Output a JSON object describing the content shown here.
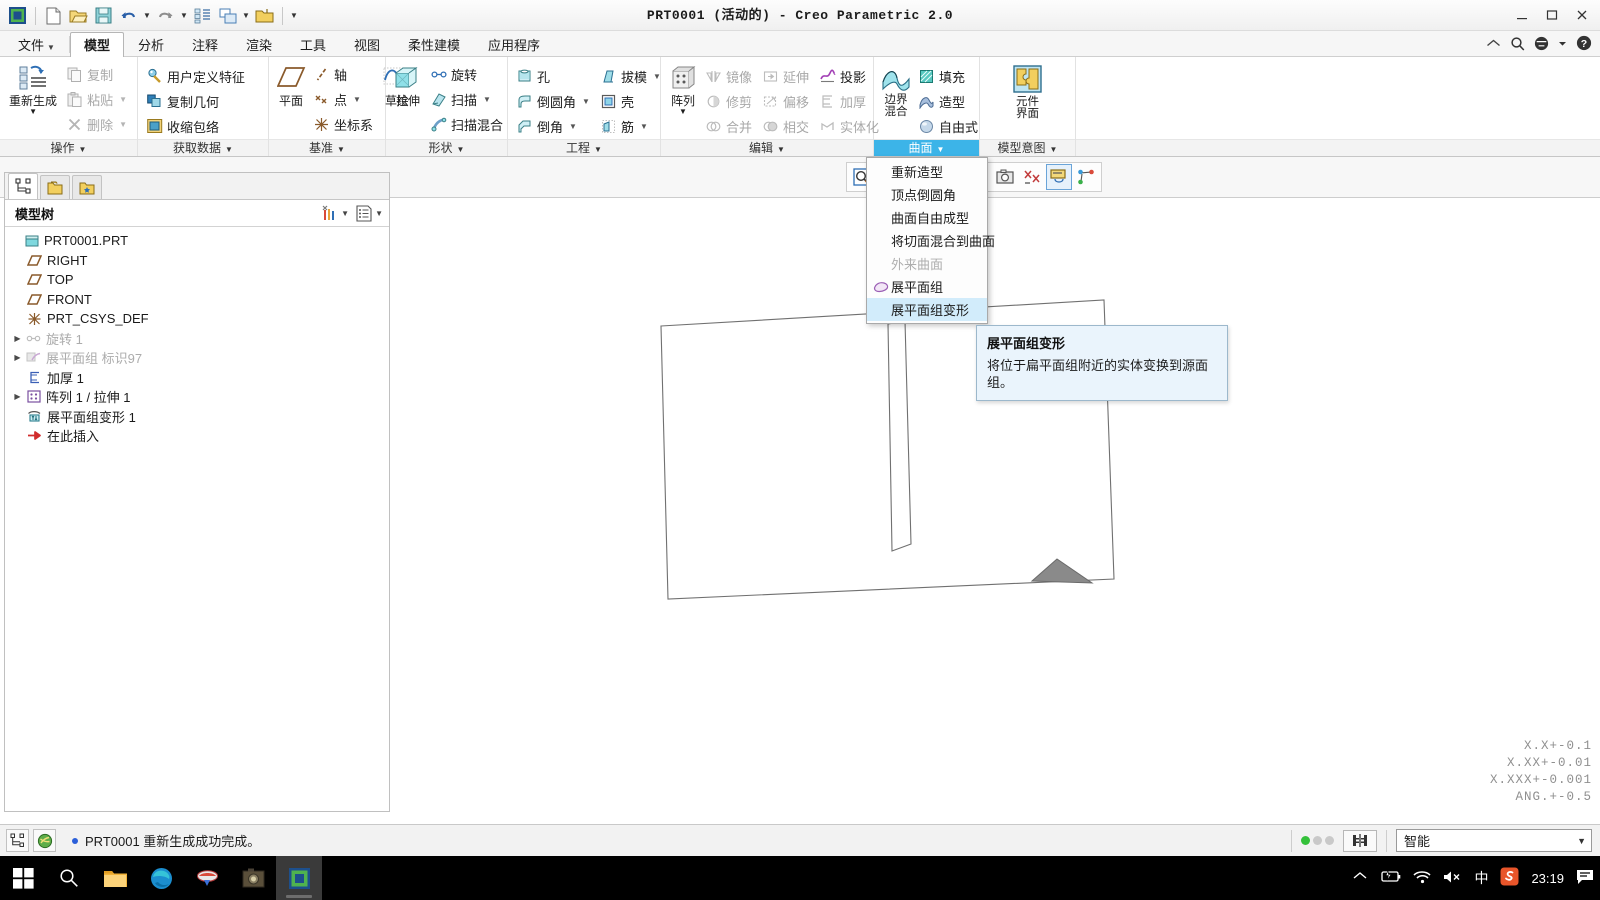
{
  "window": {
    "title": "PRT0001 (活动的) - Creo Parametric 2.0",
    "minimize": "—",
    "maximize": "☐",
    "close": "✕"
  },
  "quick_access": [
    {
      "name": "creo-logo-icon",
      "label": ""
    },
    {
      "name": "new-file-icon",
      "label": ""
    },
    {
      "name": "open-file-icon",
      "label": ""
    },
    {
      "name": "save-icon",
      "label": ""
    },
    {
      "name": "undo-icon",
      "label": ""
    },
    {
      "name": "redo-icon",
      "label": ""
    },
    {
      "name": "regenerate-icon",
      "label": ""
    },
    {
      "name": "window-switch-icon",
      "label": ""
    },
    {
      "name": "open-folder-icon",
      "label": ""
    }
  ],
  "tabs": [
    {
      "label": "文件",
      "has_dropdown": true,
      "active": false
    },
    {
      "label": "模型",
      "has_dropdown": false,
      "active": true
    },
    {
      "label": "分析",
      "has_dropdown": false,
      "active": false
    },
    {
      "label": "注释",
      "has_dropdown": false,
      "active": false
    },
    {
      "label": "渲染",
      "has_dropdown": false,
      "active": false
    },
    {
      "label": "工具",
      "has_dropdown": false,
      "active": false
    },
    {
      "label": "视图",
      "has_dropdown": false,
      "active": false
    },
    {
      "label": "柔性建模",
      "has_dropdown": false,
      "active": false
    },
    {
      "label": "应用程序",
      "has_dropdown": false,
      "active": false
    }
  ],
  "ribbon_groups": [
    {
      "label": "操作",
      "highlighted": false,
      "big": [
        {
          "label": "重新生成",
          "dropdown": true,
          "icon": "regenerate-icon"
        }
      ],
      "small": [
        {
          "label": "复制",
          "icon": "copy-icon",
          "disabled": true,
          "dropdown": false
        },
        {
          "label": "粘贴",
          "icon": "paste-icon",
          "disabled": true,
          "dropdown": true
        },
        {
          "label": "删除",
          "icon": "delete-icon",
          "disabled": true,
          "dropdown": true
        }
      ]
    },
    {
      "label": "获取数据",
      "highlighted": false,
      "big": [],
      "small": [
        {
          "label": "用户定义特征",
          "icon": "udf-icon",
          "disabled": false,
          "dropdown": false
        },
        {
          "label": "复制几何",
          "icon": "copy-geometry-icon",
          "disabled": false,
          "dropdown": false
        },
        {
          "label": "收缩包络",
          "icon": "shrinkwrap-icon",
          "disabled": false,
          "dropdown": false
        }
      ]
    },
    {
      "label": "基准",
      "highlighted": false,
      "big": [
        {
          "label": "平面",
          "dropdown": false,
          "icon": "datum-plane-icon"
        }
      ],
      "small": [
        {
          "label": "轴",
          "icon": "datum-axis-icon",
          "disabled": false,
          "dropdown": false
        },
        {
          "label": "点",
          "icon": "datum-point-icon",
          "disabled": false,
          "dropdown": true
        },
        {
          "label": "坐标系",
          "icon": "datum-csys-icon",
          "disabled": false,
          "dropdown": false
        }
      ],
      "big2": [
        {
          "label": "草绘",
          "dropdown": false,
          "icon": "sketch-icon"
        }
      ]
    },
    {
      "label": "形状",
      "highlighted": false,
      "big": [
        {
          "label": "拉伸",
          "dropdown": false,
          "icon": "extrude-icon"
        }
      ],
      "small": [
        {
          "label": "旋转",
          "icon": "revolve-icon",
          "disabled": false,
          "dropdown": false
        },
        {
          "label": "扫描",
          "icon": "sweep-icon",
          "disabled": false,
          "dropdown": true
        },
        {
          "label": "扫描混合",
          "icon": "swept-blend-icon",
          "disabled": false,
          "dropdown": false
        }
      ]
    },
    {
      "label": "工程",
      "highlighted": false,
      "big": [],
      "small": [
        {
          "label": "孔",
          "icon": "hole-icon",
          "disabled": false,
          "dropdown": false
        },
        {
          "label": "倒圆角",
          "icon": "round-icon",
          "disabled": false,
          "dropdown": true
        },
        {
          "label": "倒角",
          "icon": "chamfer-icon",
          "disabled": false,
          "dropdown": true
        }
      ],
      "small2": [
        {
          "label": "拔模",
          "icon": "draft-icon",
          "disabled": false,
          "dropdown": true
        },
        {
          "label": "壳",
          "icon": "shell-icon",
          "disabled": false,
          "dropdown": false
        },
        {
          "label": "筋",
          "icon": "rib-icon",
          "disabled": false,
          "dropdown": true
        }
      ]
    },
    {
      "label": "编辑",
      "highlighted": false,
      "big": [
        {
          "label": "阵列",
          "dropdown": true,
          "icon": "pattern-icon"
        }
      ],
      "small": [
        {
          "label": "镜像",
          "icon": "mirror-icon",
          "disabled": true,
          "dropdown": false
        },
        {
          "label": "修剪",
          "icon": "trim-icon",
          "disabled": true,
          "dropdown": false
        },
        {
          "label": "合并",
          "icon": "merge-icon",
          "disabled": true,
          "dropdown": false
        }
      ],
      "small2": [
        {
          "label": "延伸",
          "icon": "extend-icon",
          "disabled": true,
          "dropdown": false
        },
        {
          "label": "偏移",
          "icon": "offset-icon",
          "disabled": true,
          "dropdown": false
        },
        {
          "label": "相交",
          "icon": "intersect-icon",
          "disabled": true,
          "dropdown": false
        }
      ],
      "small3": [
        {
          "label": "投影",
          "icon": "project-icon",
          "disabled": false,
          "dropdown": false
        },
        {
          "label": "加厚",
          "icon": "thicken-icon",
          "disabled": true,
          "dropdown": false
        },
        {
          "label": "实体化",
          "icon": "solidify-icon",
          "disabled": true,
          "dropdown": false
        }
      ]
    },
    {
      "label": "曲面",
      "highlighted": true,
      "big": [
        {
          "label": "边界\n混合",
          "dropdown": false,
          "icon": "boundary-blend-icon"
        }
      ],
      "small": [
        {
          "label": "填充",
          "icon": "fill-icon",
          "disabled": false,
          "dropdown": false
        },
        {
          "label": "造型",
          "icon": "style-icon",
          "disabled": false,
          "dropdown": false
        },
        {
          "label": "自由式",
          "icon": "freestyle-icon",
          "disabled": false,
          "dropdown": false
        }
      ]
    },
    {
      "label": "模型意图",
      "highlighted": false,
      "big": [
        {
          "label": "元件\n界面",
          "dropdown": false,
          "icon": "component-interface-icon"
        }
      ],
      "small": []
    }
  ],
  "surface_menu": {
    "items": [
      {
        "label": "重新造型",
        "disabled": false,
        "selected": false,
        "icon": ""
      },
      {
        "label": "顶点倒圆角",
        "disabled": false,
        "selected": false,
        "icon": ""
      },
      {
        "label": "曲面自由成型",
        "disabled": false,
        "selected": false,
        "icon": ""
      },
      {
        "label": "将切面混合到曲面",
        "disabled": false,
        "selected": false,
        "icon": ""
      },
      {
        "label": "外来曲面",
        "disabled": true,
        "selected": false,
        "icon": ""
      },
      {
        "label": "展平面组",
        "disabled": false,
        "selected": false,
        "icon": "flatten-quilt-icon"
      },
      {
        "label": "展平面组变形",
        "disabled": false,
        "selected": true,
        "icon": ""
      }
    ]
  },
  "tooltip": {
    "title": "展平面组变形",
    "body": "将位于扁平面组附近的实体变换到源面组。"
  },
  "nav_panel": {
    "tabs": [
      {
        "name": "model-tree-tab",
        "active": true
      },
      {
        "name": "folder-browser-tab",
        "active": false
      },
      {
        "name": "favorites-tab",
        "active": false
      }
    ],
    "header_title": "模型树",
    "tree": [
      {
        "label": "PRT0001.PRT",
        "icon": "part-icon",
        "indent": 0,
        "expand": "",
        "suppressed": false
      },
      {
        "label": "RIGHT",
        "icon": "datum-plane-icon",
        "indent": 1,
        "expand": "",
        "suppressed": false
      },
      {
        "label": "TOP",
        "icon": "datum-plane-icon",
        "indent": 1,
        "expand": "",
        "suppressed": false
      },
      {
        "label": "FRONT",
        "icon": "datum-plane-icon",
        "indent": 1,
        "expand": "",
        "suppressed": false
      },
      {
        "label": "PRT_CSYS_DEF",
        "icon": "datum-csys-icon",
        "indent": 1,
        "expand": "",
        "suppressed": false
      },
      {
        "label": "旋转 1",
        "icon": "revolve-icon",
        "indent": 1,
        "expand": "▶",
        "suppressed": true
      },
      {
        "label": "展平面组 标识97",
        "icon": "flatten-quilt-icon",
        "indent": 1,
        "expand": "▶",
        "suppressed": true
      },
      {
        "label": "加厚 1",
        "icon": "thicken-icon",
        "indent": 1,
        "expand": "",
        "suppressed": false
      },
      {
        "label": "阵列 1 / 拉伸 1",
        "icon": "pattern-icon",
        "indent": 1,
        "expand": "▶",
        "suppressed": false
      },
      {
        "label": "展平面组变形 1",
        "icon": "flatten-deform-icon",
        "indent": 1,
        "expand": "",
        "suppressed": false
      },
      {
        "label": "在此插入",
        "icon": "insert-here-icon",
        "indent": 1,
        "expand": "",
        "suppressed": false
      }
    ]
  },
  "graphics_toolbar": [
    {
      "name": "repaint-icon",
      "selected": false
    },
    {
      "name": "zoom-in-icon",
      "selected": false
    },
    {
      "name": "zoom-out-icon",
      "selected": false
    },
    {
      "name": "refit-icon",
      "selected": false
    },
    {
      "name": "datum-display-icon",
      "selected": false
    },
    {
      "name": "annotation-display-icon",
      "selected": false
    },
    {
      "name": "saved-views-icon",
      "selected": false
    },
    {
      "name": "view-manager-icon",
      "selected": false
    },
    {
      "name": "display-style-icon",
      "selected": true
    },
    {
      "name": "appearance-icon",
      "selected": false
    }
  ],
  "canvas": {
    "tolerance_lines": [
      "X.X+-0.1",
      "X.XX+-0.01",
      "X.XXX+-0.001",
      "ANG.+-0.5"
    ]
  },
  "status_bar": {
    "message": "PRT0001 重新生成成功完成。",
    "selection_filter": "智能",
    "filter_arrow": "▼",
    "led_colors": [
      "#34c13a",
      "#c9c9c9",
      "#c9c9c9"
    ]
  },
  "taskbar": {
    "items": [
      {
        "name": "start-button"
      },
      {
        "name": "search-icon"
      },
      {
        "name": "file-explorer-icon"
      },
      {
        "name": "edge-browser-icon"
      },
      {
        "name": "wps-icon"
      },
      {
        "name": "photos-icon"
      },
      {
        "name": "creo-app-icon"
      }
    ],
    "tray": [
      {
        "name": "show-hidden-icons",
        "glyph": "︿"
      },
      {
        "name": "battery-icon",
        "glyph": ""
      },
      {
        "name": "wifi-icon",
        "glyph": ""
      },
      {
        "name": "volume-muted-icon",
        "glyph": ""
      },
      {
        "name": "ime-chinese-icon",
        "glyph": "中"
      },
      {
        "name": "sogou-input-icon",
        "glyph": "S"
      }
    ],
    "clock": "23:19",
    "notification": "notification-icon"
  },
  "colors": {
    "accent_blue": "#3cb4e8",
    "menu_select": "#d2ecfb",
    "tooltip_bg": "#eaf4fc",
    "disabled_text": "#a8a8a8",
    "datum_brown": "#8a5a2b"
  }
}
